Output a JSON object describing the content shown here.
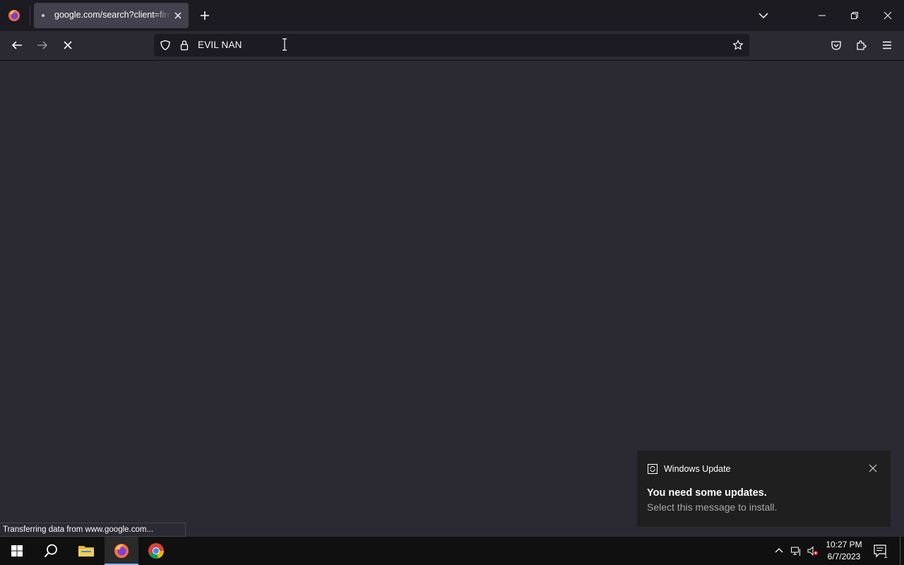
{
  "browser": {
    "tab": {
      "title": "google.com/search?client=firefox"
    },
    "url_text": "EVIL NAN",
    "status_text": "Transferring data from www.google.com..."
  },
  "toast": {
    "app_name": "Windows Update",
    "heading": "You need some updates.",
    "body": "Select this message to install."
  },
  "taskbar": {
    "time": "10:27 PM",
    "date": "6/7/2023",
    "notification_count": "1"
  },
  "colors": {
    "page_bg": "#2b2a33",
    "tabstrip_bg": "#1c1b22",
    "selected_tab_bg": "#42414d",
    "taskbar_bg": "#101010",
    "toast_bg": "#1f1f1f"
  }
}
